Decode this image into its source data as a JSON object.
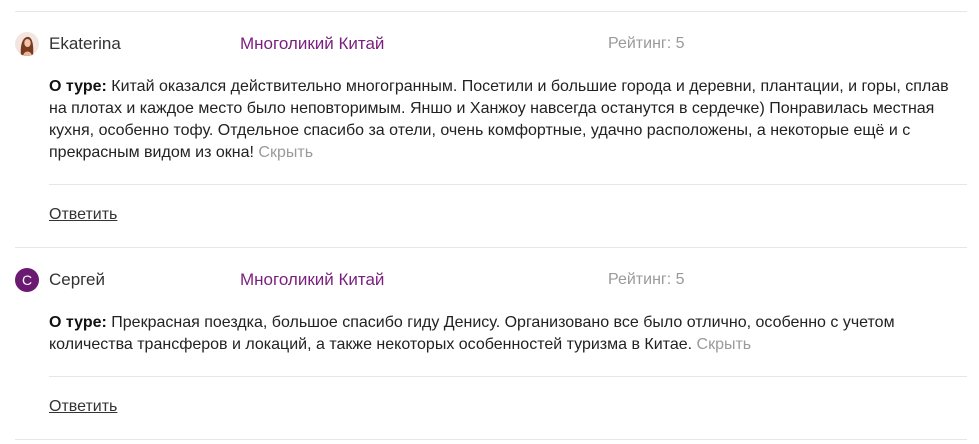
{
  "reviews": [
    {
      "author": "Ekaterina",
      "avatar_icon": "user-photo-avatar",
      "tour": "Многоликий Китай",
      "rating": "Рейтинг: 5",
      "about_label": "О туре:",
      "text": "Китай оказался действительно многогранным. Посетили и большие города и деревни, плантации, и горы, сплав на плотах и каждое место было неповторимым. Яншо и Ханжоу навсегда останутся в сердечке) Понравилась местная кухня, особенно тофу. Отдельное спасибо за отели, очень комфортные, удачно расположены, а некоторые ещё и с прекрасным видом из окна!",
      "hide_label": "Скрыть",
      "reply_label": "Ответить"
    },
    {
      "author": "Сергей",
      "avatar_letter": "С",
      "tour": "Многоликий Китай",
      "rating": "Рейтинг: 5",
      "about_label": "О туре:",
      "text": "Прекрасная поездка, большое спасибо гиду Денису. Организовано все было отлично, особенно с учетом количества трансферов и локаций, а также некоторых особенностей туризма в Китае.",
      "hide_label": "Скрыть",
      "reply_label": "Ответить"
    }
  ],
  "colors": {
    "accent": "#7a1f7e",
    "avatar_bg": "#6b1a72",
    "muted": "#9a9a9a",
    "divider": "#e6e6e6"
  }
}
